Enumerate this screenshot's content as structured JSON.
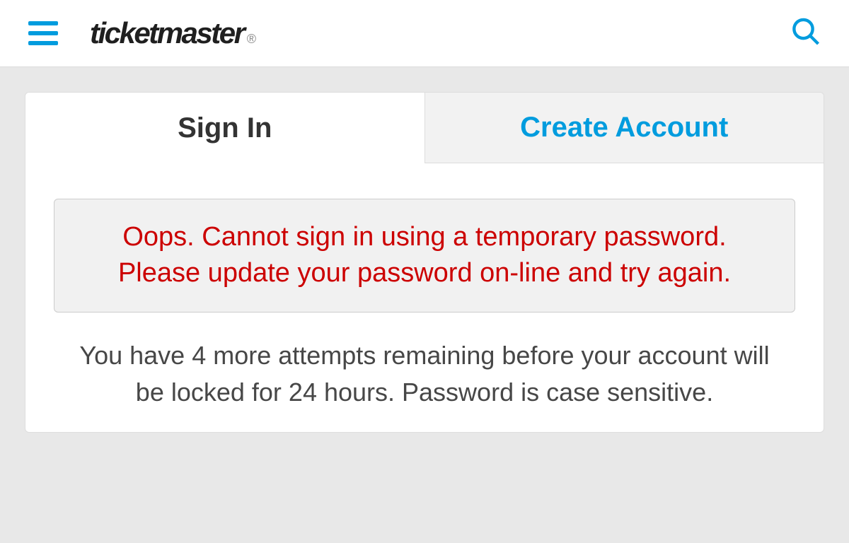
{
  "header": {
    "brand": "ticketmaster",
    "brand_mark": "®"
  },
  "tabs": {
    "sign_in": "Sign In",
    "create_account": "Create Account"
  },
  "error": {
    "message": "Oops. Cannot sign in using a temporary password. Please update your password on-line and try again."
  },
  "attempts": {
    "text": "You have 4 more attempts remaining before your account will be locked for 24 hours. Password is case sensitive."
  },
  "colors": {
    "brand_blue": "#009cde",
    "error_red": "#cc0000"
  }
}
